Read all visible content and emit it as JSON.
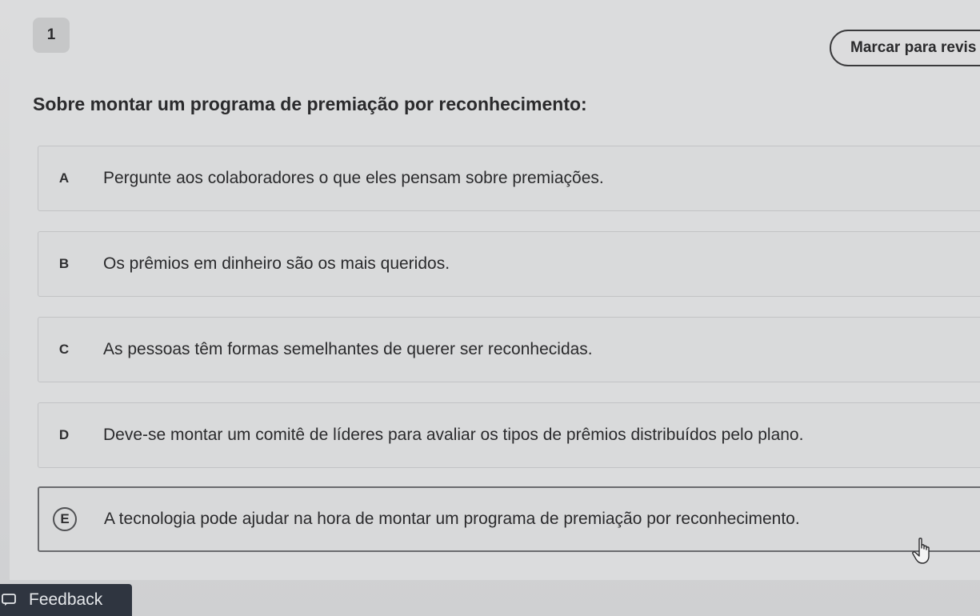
{
  "question": {
    "number": "1",
    "mark_review_label": "Marcar para revis",
    "prompt": "Sobre montar um programa de premiação por reconhecimento:"
  },
  "options": [
    {
      "letter": "A",
      "text": "Pergunte aos colaboradores o que eles pensam sobre premiações."
    },
    {
      "letter": "B",
      "text": "Os prêmios em dinheiro são os mais queridos."
    },
    {
      "letter": "C",
      "text": "As pessoas têm formas semelhantes de querer ser reconhecidas."
    },
    {
      "letter": "D",
      "text": "Deve-se montar um comitê de líderes para avaliar os tipos de prêmios distribuídos pelo plano."
    },
    {
      "letter": "E",
      "text": "A tecnologia pode ajudar na hora de montar um programa de premiação por reconhecimento."
    }
  ],
  "selected_option": "E",
  "feedback": {
    "label": "Feedback"
  },
  "icons": {
    "cursor": "hand-pointer-icon",
    "feedback": "feedback-icon"
  },
  "colors": {
    "background": "#dbdcdd",
    "text": "#2a2a2c",
    "feedback_bar": "#2f3540"
  }
}
